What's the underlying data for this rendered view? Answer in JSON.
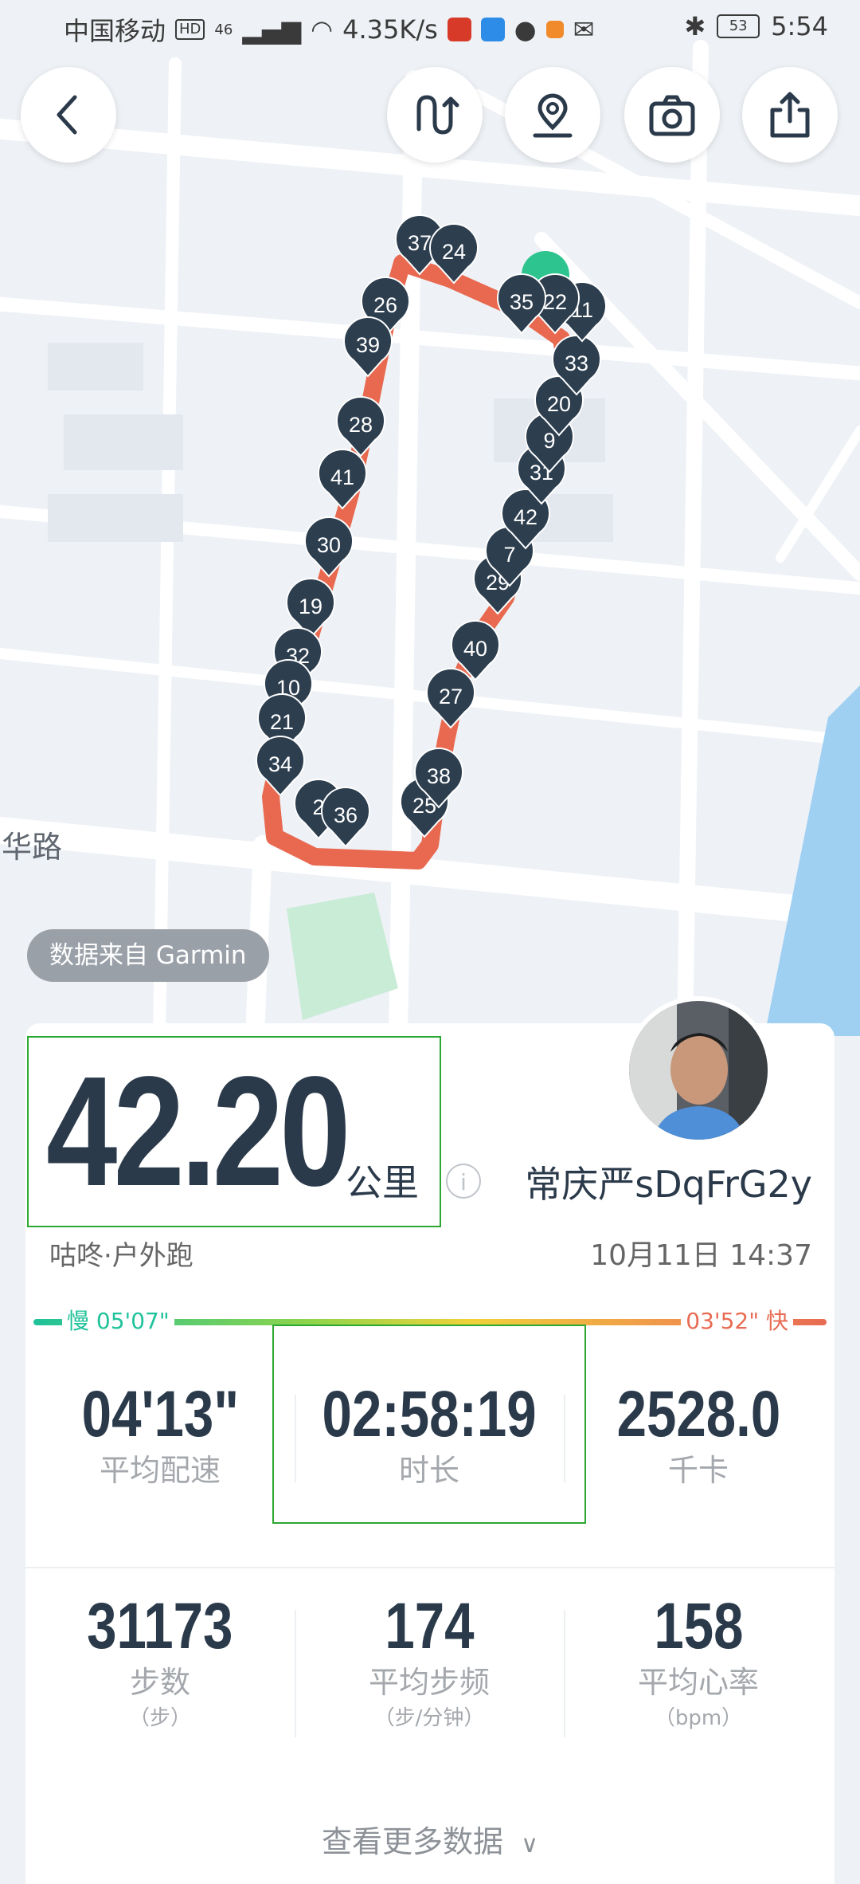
{
  "status_bar": {
    "carrier": "中国移动",
    "hd": "HD",
    "network": "46",
    "speed": "4.35K/s",
    "battery": "53",
    "time": "5:54"
  },
  "map": {
    "road_label": "华路",
    "source_label": "数据来自 Garmin",
    "km_markers": [
      "37",
      "24",
      "26",
      "39",
      "28",
      "41",
      "30",
      "19",
      "32",
      "10",
      "21",
      "34",
      "2",
      "36",
      "25",
      "38",
      "27",
      "40",
      "29",
      "7",
      "42",
      "31",
      "9",
      "20",
      "33",
      "11",
      "22",
      "35"
    ]
  },
  "toolbar": {
    "back_icon": "back-arrow-icon",
    "route_icon": "route-icon",
    "location_icon": "location-pin-icon",
    "camera_icon": "camera-icon",
    "share_icon": "share-icon"
  },
  "summary": {
    "distance": "42.20",
    "distance_unit": "公里",
    "info_icon": "i",
    "username": "常庆严sDqFrG2y",
    "sport_type": "咕咚·户外跑",
    "datetime": "10月11日 14:37"
  },
  "pace_scale": {
    "slow_label": "慢 05'07\"",
    "fast_label": "03'52\" 快",
    "slow_color": "#1fc29a",
    "fast_color": "#e86b53"
  },
  "stats": [
    {
      "value": "04'13\"",
      "label": "平均配速",
      "unit": ""
    },
    {
      "value": "02:58:19",
      "label": "时长",
      "unit": ""
    },
    {
      "value": "2528.0",
      "label": "千卡",
      "unit": ""
    },
    {
      "value": "31173",
      "label": "步数",
      "unit": "（步）"
    },
    {
      "value": "174",
      "label": "平均步频",
      "unit": "（步/分钟）"
    },
    {
      "value": "158",
      "label": "平均心率",
      "unit": "（bpm）"
    }
  ],
  "more_data_label": "查看更多数据",
  "colors": {
    "route": "#e8694f",
    "marker": "#2d3e4f",
    "highlight_border": "#2aa831"
  }
}
